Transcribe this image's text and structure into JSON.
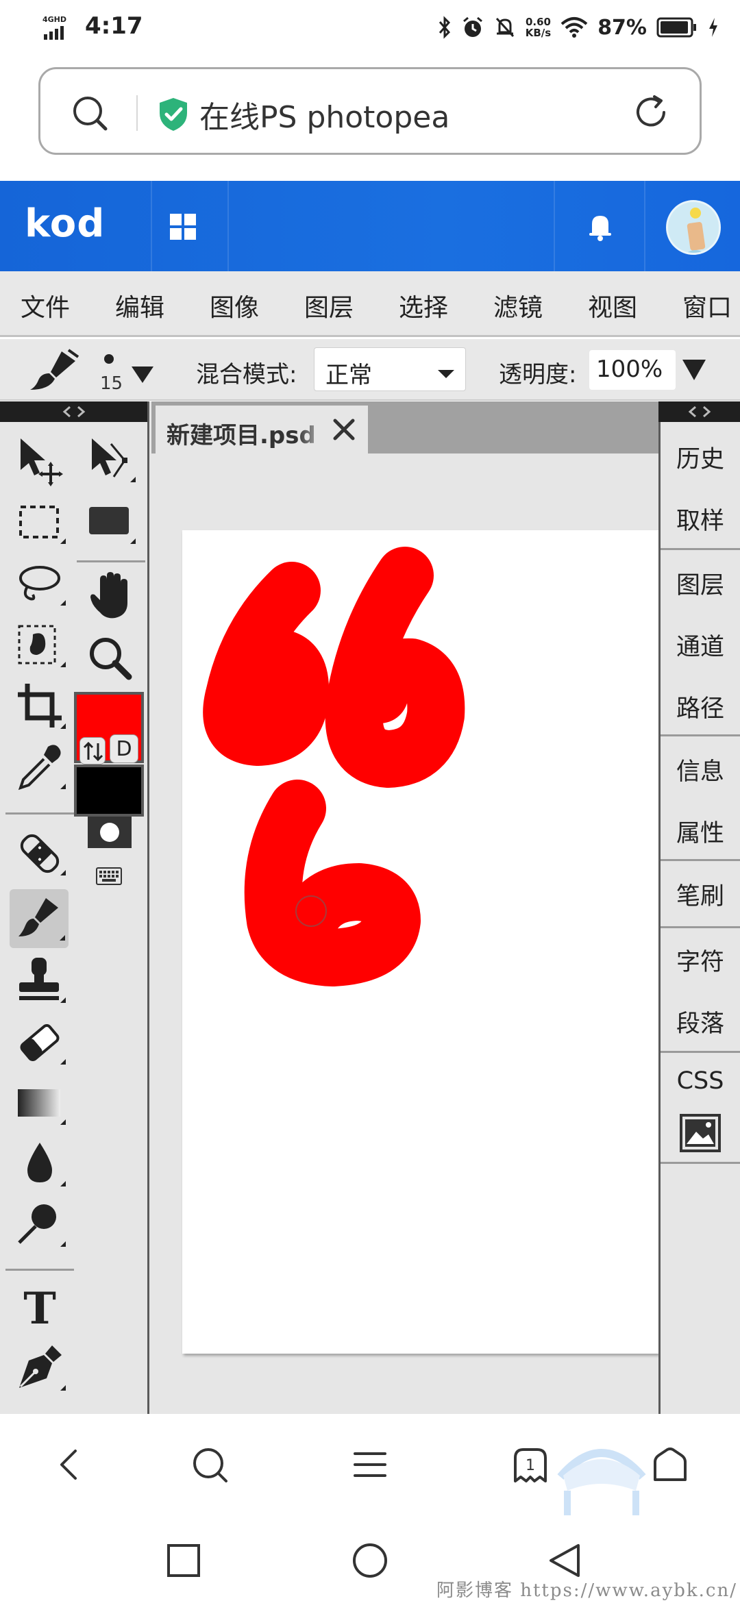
{
  "status_bar": {
    "network": "4GHD",
    "time": "4:17",
    "speed_value": "0.60",
    "speed_unit": "KB/s",
    "battery": "87%"
  },
  "url_bar": {
    "title": "在线PS photopea"
  },
  "kod_header": {
    "logo": "kod"
  },
  "menu": {
    "items": [
      "文件",
      "编辑",
      "图像",
      "图层",
      "选择",
      "滤镜",
      "视图",
      "窗口"
    ]
  },
  "options": {
    "brush_size": "15",
    "blend_label": "混合模式:",
    "blend_value": "正常",
    "opacity_label": "透明度:",
    "opacity_value": "100%"
  },
  "document": {
    "tab_name": "新建项目.psd",
    "drawing_text": "666",
    "colors": {
      "foreground": "#ff0000",
      "background": "#000000"
    }
  },
  "tools": {
    "default_colors_label": "D"
  },
  "right_panel": {
    "items": [
      "历史",
      "取样",
      "图层",
      "通道",
      "路径",
      "信息",
      "属性",
      "笔刷",
      "字符",
      "段落",
      "CSS"
    ]
  },
  "watermark": "阿影博客 https://www.aybk.cn/"
}
